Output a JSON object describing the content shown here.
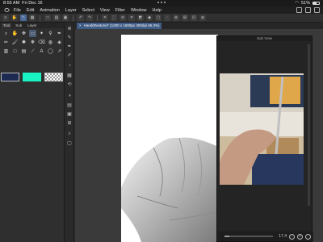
{
  "status": {
    "time": "8:55 AM",
    "date": "Fri Dec 16",
    "battery": "51%",
    "battery_level": 0.51
  },
  "menubar": {
    "items": [
      "File",
      "Edit",
      "Animation",
      "Layer",
      "Select",
      "View",
      "Filter",
      "Window",
      "Help"
    ]
  },
  "tool_panel": {
    "tabs": [
      "Tool",
      "Sub",
      "Layer"
    ]
  },
  "document": {
    "tab_label": "Hand(Restore)* (1200 x 1600px 300dpi 65.3%)"
  },
  "subview": {
    "title": "Sub View",
    "zoom": "17.4"
  },
  "colors": {
    "main_color": "#1c2a52",
    "sub_color": "#19f2c2",
    "accent": "#3f5c86"
  }
}
